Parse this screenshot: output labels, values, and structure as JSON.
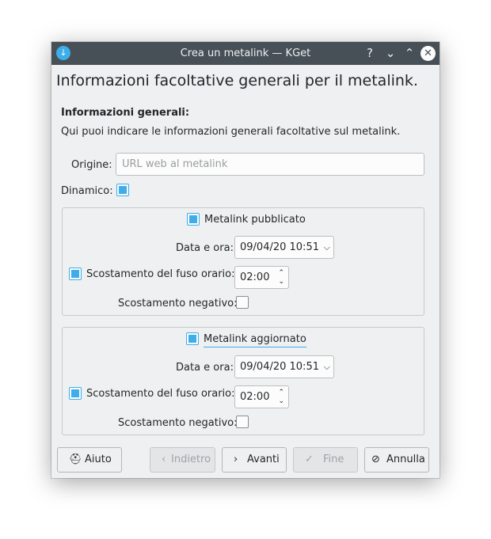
{
  "window": {
    "title": "Crea un metalink — KGet",
    "app_icon": "↓",
    "help": "?",
    "minimize": "⌄",
    "maximize": "⌃",
    "close": "✕"
  },
  "page": {
    "heading": "Informazioni facoltative generali per il metalink.",
    "section_title": "Informazioni generali:",
    "section_desc": "Qui puoi indicare le informazioni generali facoltative sul metalink."
  },
  "origin": {
    "label": "Origine:",
    "value": "",
    "placeholder": "URL web al metalink"
  },
  "dynamic": {
    "label": "Dinamico:",
    "checked": true
  },
  "published": {
    "checkbox_label": "Metalink pubblicato",
    "checked": true,
    "date_label": "Data e ora:",
    "date_value": "09/04/20 10:51",
    "tz_label": "Scostamento del fuso orario:",
    "tz_checked": true,
    "tz_value": "02:00",
    "negative_label": "Scostamento negativo:",
    "negative_checked": false
  },
  "updated": {
    "checkbox_label": "Metalink aggiornato",
    "checked": true,
    "date_label": "Data e ora:",
    "date_value": "09/04/20 10:51",
    "tz_label": "Scostamento del fuso orario:",
    "tz_checked": true,
    "tz_value": "02:00",
    "negative_label": "Scostamento negativo:",
    "negative_checked": false
  },
  "buttons": {
    "help": {
      "label": "Aiuto",
      "icon": "⛑",
      "enabled": true
    },
    "back": {
      "label": "Indietro",
      "icon": "‹",
      "enabled": false
    },
    "next": {
      "label": "Avanti",
      "icon": "›",
      "enabled": true
    },
    "finish": {
      "label": "Fine",
      "icon": "✓",
      "enabled": false
    },
    "cancel": {
      "label": "Annulla",
      "icon": "⊘",
      "enabled": true
    }
  },
  "icons": {
    "combo_arrow": "chevron-down-icon",
    "spin_up": "spin-up-icon",
    "spin_down": "spin-down-icon"
  },
  "colors": {
    "accent": "#3daee9",
    "titlebar": "#475057",
    "window_bg": "#eff0f1"
  }
}
